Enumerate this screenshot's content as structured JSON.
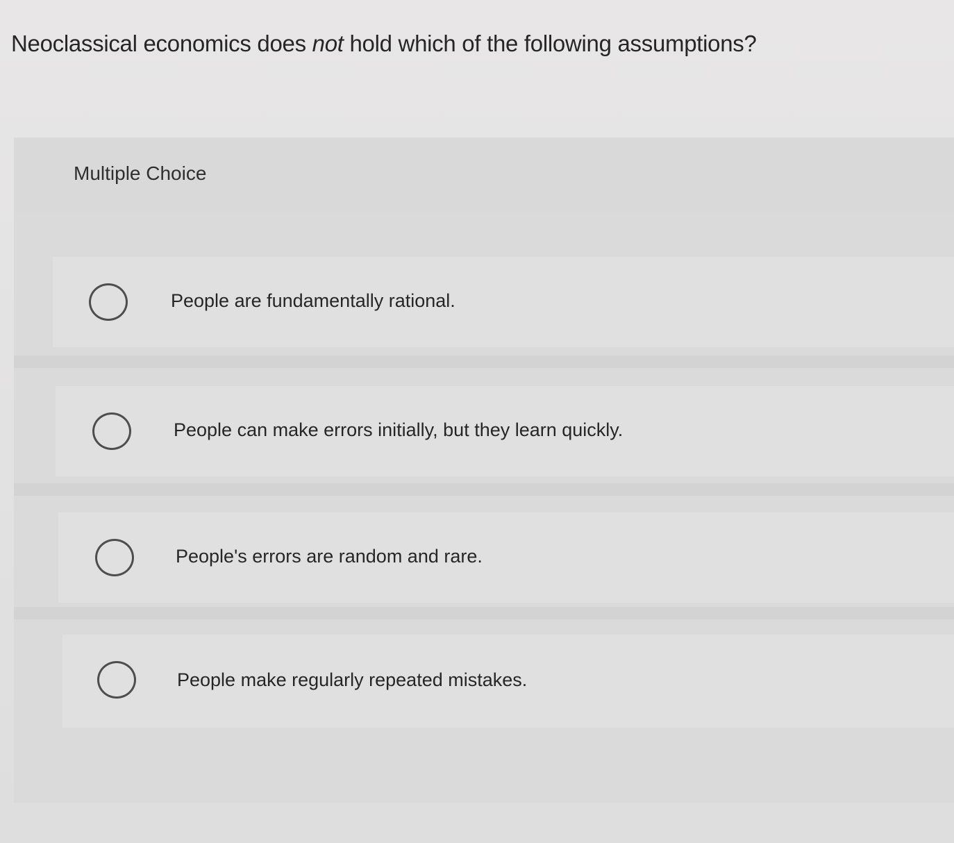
{
  "question": {
    "prefix": "Neoclassical economics does ",
    "emphasis": "not",
    "suffix": " hold which of the following assumptions?"
  },
  "card": {
    "label": "Multiple Choice"
  },
  "options": [
    {
      "label": "People are fundamentally rational.",
      "selected": false
    },
    {
      "label": "People can make errors initially, but they learn quickly.",
      "selected": false
    },
    {
      "label": "People's errors are random and rare.",
      "selected": false
    },
    {
      "label": "People make regularly repeated mistakes.",
      "selected": false
    }
  ]
}
